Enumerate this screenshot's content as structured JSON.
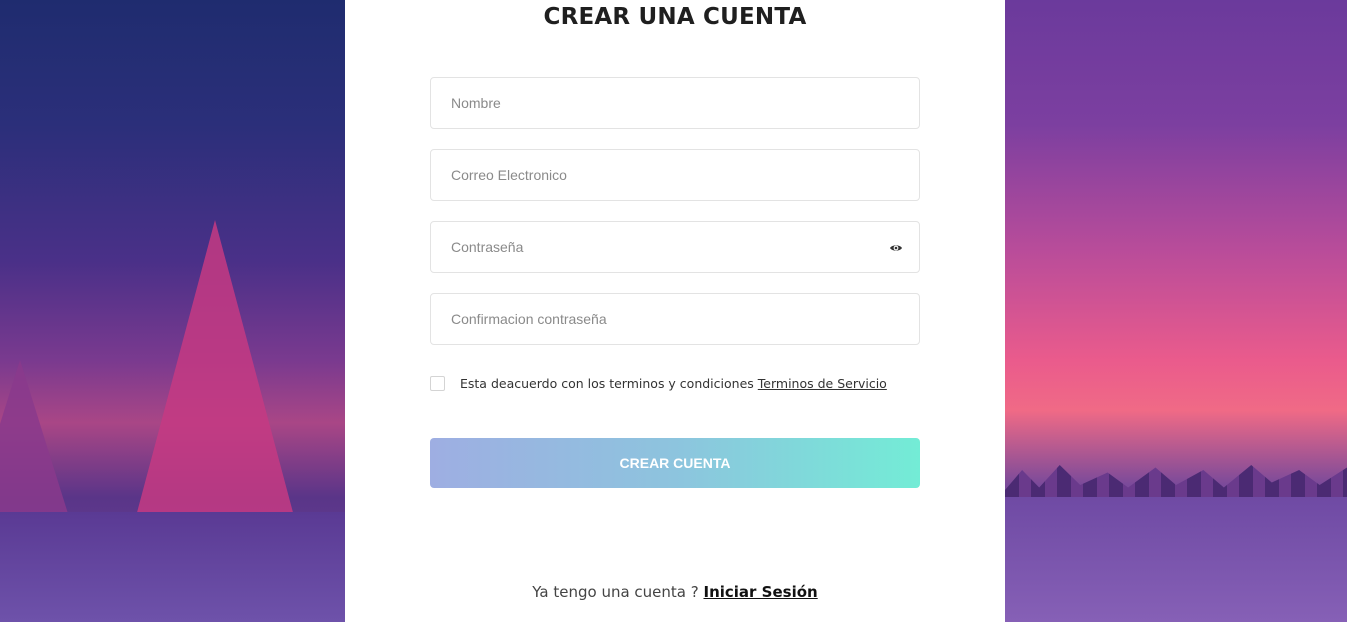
{
  "form": {
    "title": "CREAR UNA CUENTA",
    "fields": {
      "name_placeholder": "Nombre",
      "email_placeholder": "Correo Electronico",
      "password_placeholder": "Contraseña",
      "confirm_placeholder": "Confirmacion contraseña"
    },
    "terms_text": "Esta deacuerdo con los terminos y condiciones",
    "terms_link": "Terminos de Servicio",
    "submit_label": "CREAR CUENTA",
    "signin_prompt": "Ya tengo una cuenta ?",
    "signin_link": "Iniciar Sesión"
  },
  "icons": {
    "password_toggle": "eye-icon"
  },
  "colors": {
    "button_gradient_start": "#9eaee2",
    "button_gradient_end": "#73ecd6",
    "card_background": "#ffffff"
  }
}
